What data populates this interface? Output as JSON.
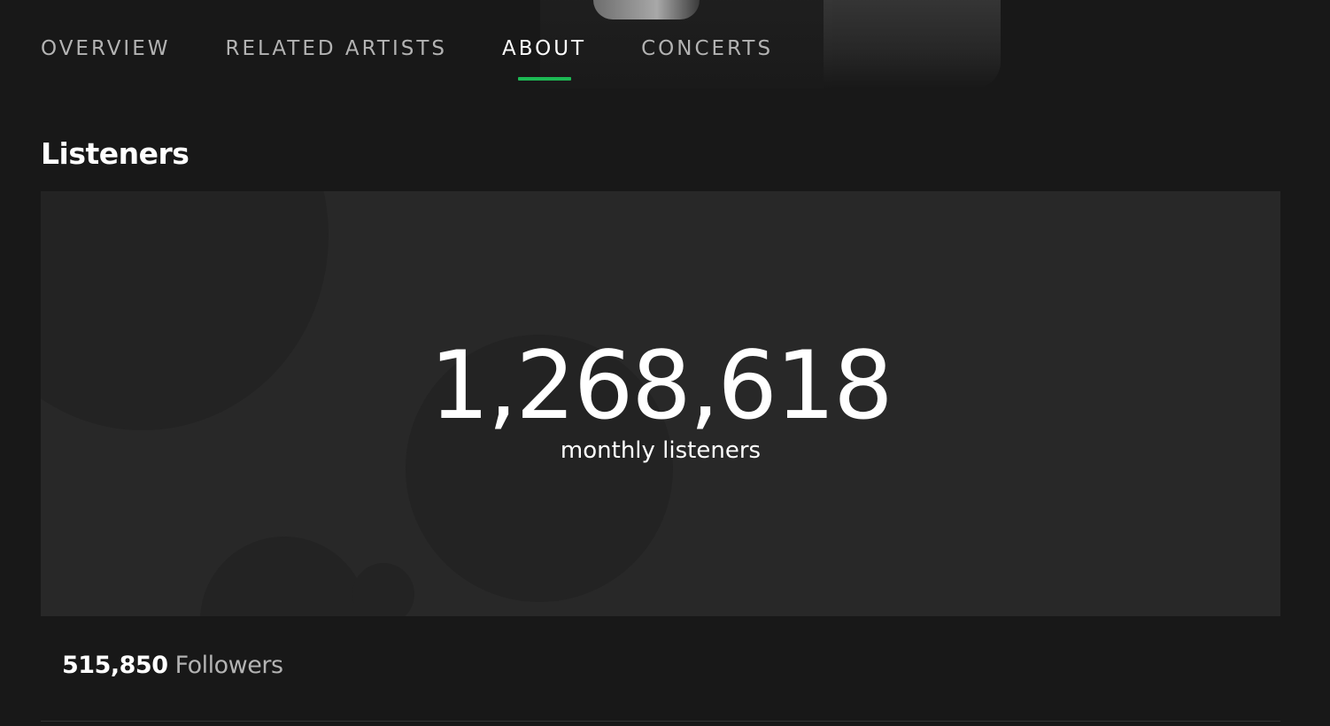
{
  "tabs": [
    {
      "label": "OVERVIEW",
      "active": false
    },
    {
      "label": "RELATED ARTISTS",
      "active": false
    },
    {
      "label": "ABOUT",
      "active": true
    },
    {
      "label": "CONCERTS",
      "active": false
    }
  ],
  "section": {
    "title": "Listeners"
  },
  "listeners": {
    "count": "1,268,618",
    "label": "monthly listeners"
  },
  "followers": {
    "count": "515,850",
    "label": "Followers"
  },
  "colors": {
    "accent": "#1db954",
    "background": "#181818",
    "card": "#282828",
    "text_muted": "#b3b3b3"
  }
}
